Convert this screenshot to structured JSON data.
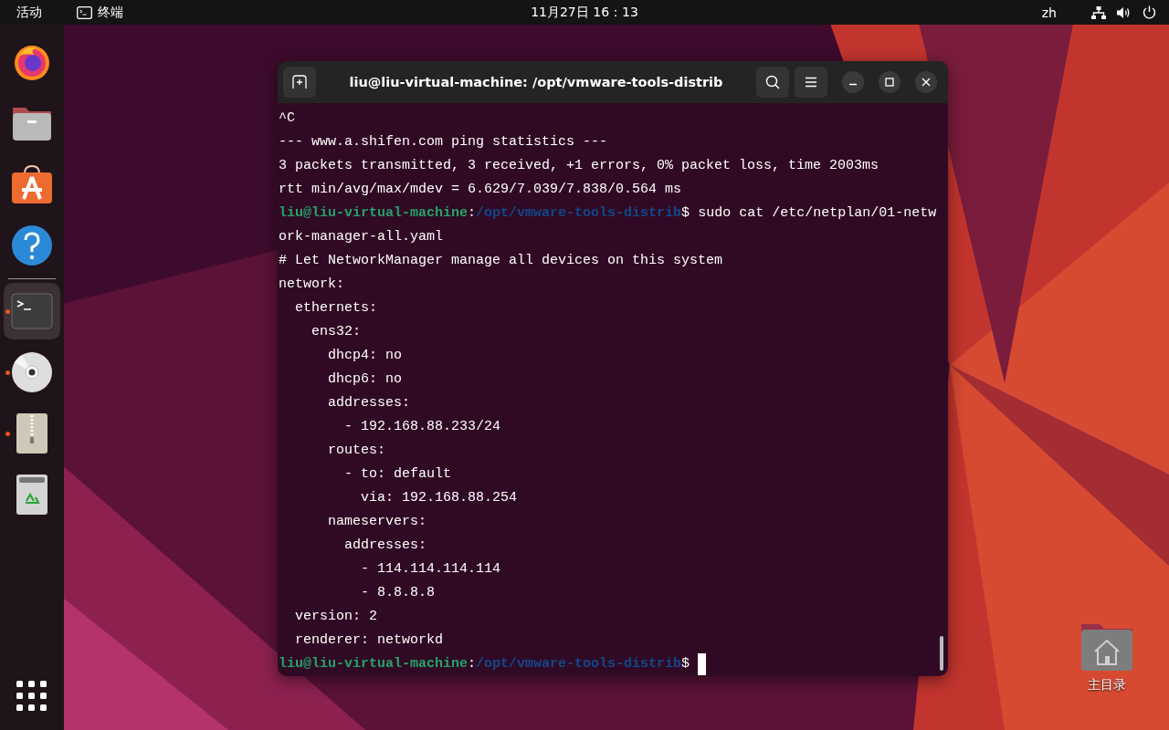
{
  "top_bar": {
    "activities": "活动",
    "app_name": "终端",
    "clock": "11月27日 16：13",
    "input_method": "zh"
  },
  "dock": {
    "items": [
      {
        "kind": "firefox",
        "running": false,
        "selected": false
      },
      {
        "kind": "files",
        "running": false,
        "selected": false
      },
      {
        "kind": "store",
        "running": false,
        "selected": false
      },
      {
        "kind": "help",
        "running": false,
        "selected": false
      },
      {
        "kind": "terminal",
        "running": true,
        "selected": true
      },
      {
        "kind": "disc",
        "running": true,
        "selected": false
      },
      {
        "kind": "archive",
        "running": true,
        "selected": false
      },
      {
        "kind": "trash",
        "running": false,
        "selected": false
      }
    ]
  },
  "terminal": {
    "title": "liu@liu-virtual-machine: /opt/vmware-tools-distrib",
    "lines": [
      {
        "kind": "output",
        "text": "^C"
      },
      {
        "kind": "output",
        "text": "--- www.a.shifen.com ping statistics ---"
      },
      {
        "kind": "output",
        "text": "3 packets transmitted, 3 received, +1 errors, 0% packet loss, time 2003ms"
      },
      {
        "kind": "output",
        "text": "rtt min/avg/max/mdev = 6.629/7.039/7.838/0.564 ms"
      },
      {
        "kind": "prompt",
        "user": "liu@liu-virtual-machine",
        "separator": ":",
        "path": "/opt/vmware-tools-distrib",
        "symbol": "$",
        "command": "sudo cat /etc/netplan/01-netw"
      },
      {
        "kind": "output",
        "text": "ork-manager-all.yaml"
      },
      {
        "kind": "output",
        "text": "# Let NetworkManager manage all devices on this system"
      },
      {
        "kind": "output",
        "text": "network:"
      },
      {
        "kind": "output",
        "text": "  ethernets:"
      },
      {
        "kind": "output",
        "text": "    ens32:"
      },
      {
        "kind": "output",
        "text": "      dhcp4: no"
      },
      {
        "kind": "output",
        "text": "      dhcp6: no"
      },
      {
        "kind": "output",
        "text": "      addresses:"
      },
      {
        "kind": "output",
        "text": "        - 192.168.88.233/24"
      },
      {
        "kind": "output",
        "text": "      routes:"
      },
      {
        "kind": "output",
        "text": "        - to: default"
      },
      {
        "kind": "output",
        "text": "          via: 192.168.88.254"
      },
      {
        "kind": "output",
        "text": "      nameservers:"
      },
      {
        "kind": "output",
        "text": "        addresses:"
      },
      {
        "kind": "output",
        "text": "          - 114.114.114.114"
      },
      {
        "kind": "output",
        "text": "          - 8.8.8.8"
      },
      {
        "kind": "output",
        "text": "  version: 2"
      },
      {
        "kind": "output",
        "text": "  renderer: networkd"
      },
      {
        "kind": "prompt",
        "user": "liu@liu-virtual-machine",
        "separator": ":",
        "path": "/opt/vmware-tools-distrib",
        "symbol": "$",
        "cursor": true
      }
    ]
  },
  "desktop_icons": [
    {
      "label": "主目录"
    }
  ]
}
